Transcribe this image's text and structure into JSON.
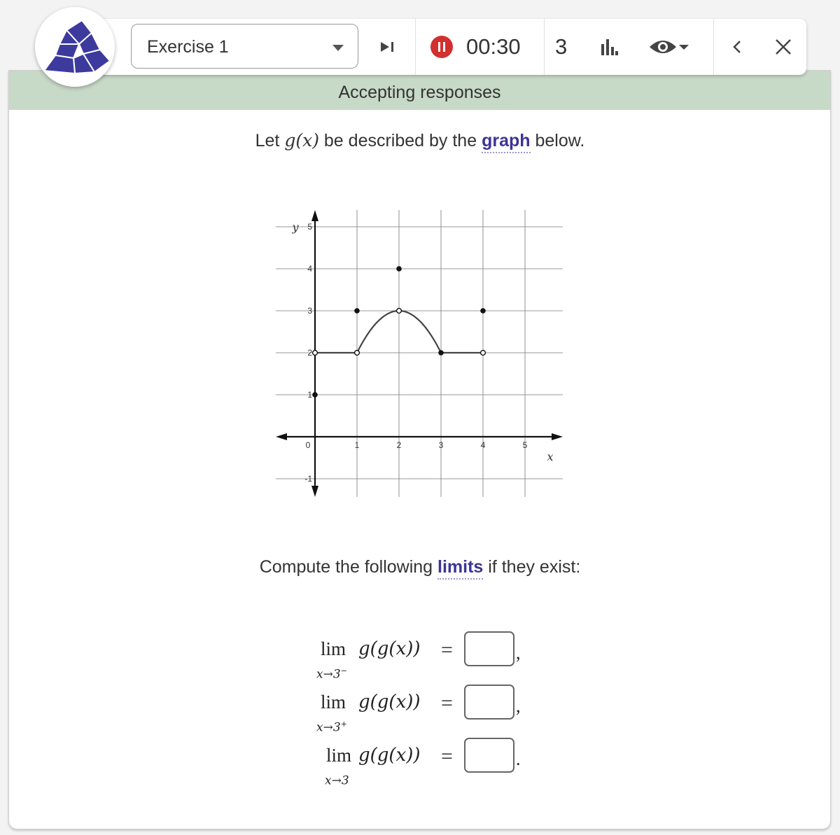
{
  "toolbar": {
    "exercise_select": "Exercise 1",
    "timer": "00:30",
    "count": "3"
  },
  "status": "Accepting responses",
  "question": {
    "intro_before": "Let",
    "intro_func": "g(x)",
    "intro_mid": "be described by the",
    "intro_link": "graph",
    "intro_after": "below.",
    "compute_before": "Compute the following",
    "compute_link": "limits",
    "compute_after": "if they exist:"
  },
  "chart_data": {
    "type": "line",
    "xlabel": "x",
    "ylabel": "y",
    "xlim": [
      -1,
      6
    ],
    "ylim": [
      -1.4,
      5.4
    ],
    "x_ticks": [
      "0",
      "1",
      "2",
      "3",
      "4",
      "5"
    ],
    "y_ticks": [
      "-1",
      "1",
      "2",
      "3",
      "4",
      "5"
    ],
    "grid": true,
    "segments": [
      {
        "kind": "line",
        "points": [
          [
            0,
            2
          ],
          [
            1,
            2
          ]
        ]
      },
      {
        "kind": "parabola",
        "vertex": [
          2,
          3
        ],
        "from": [
          1,
          2
        ],
        "to": [
          3,
          2
        ]
      },
      {
        "kind": "line",
        "points": [
          [
            3,
            2
          ],
          [
            4,
            2
          ]
        ]
      }
    ],
    "open_points": [
      [
        0,
        2
      ],
      [
        1,
        2
      ],
      [
        2,
        3
      ],
      [
        4,
        2
      ]
    ],
    "closed_points": [
      [
        0,
        1
      ],
      [
        1,
        3
      ],
      [
        2,
        4
      ],
      [
        3,
        2
      ],
      [
        4,
        3
      ]
    ]
  },
  "limits": [
    {
      "lim": "lim",
      "var": "x",
      "arrow": "→",
      "point": "3",
      "side": "−",
      "fn": "g(g(x))",
      "eq": "=",
      "punct": ","
    },
    {
      "lim": "lim",
      "var": "x",
      "arrow": "→",
      "point": "3",
      "side": "+",
      "fn": "g(g(x))",
      "eq": "=",
      "punct": ","
    },
    {
      "lim": "lim",
      "var": "x",
      "arrow": "→",
      "point": "3",
      "side": "",
      "fn": "g(g(x))",
      "eq": "=",
      "punct": "."
    }
  ],
  "icons": {
    "logo": "cube-net-logo-icon",
    "step": "step-forward-icon",
    "pause": "pause-icon",
    "stats": "bar-chart-icon",
    "visibility": "eye-icon",
    "dropdown": "chevron-down-icon",
    "back": "chevron-left-icon",
    "close": "close-icon"
  },
  "colors": {
    "status_bar": "#c7d9c7",
    "link": "#3b3596",
    "logo": "#3d3a9e",
    "pause": "#d32f2f"
  }
}
